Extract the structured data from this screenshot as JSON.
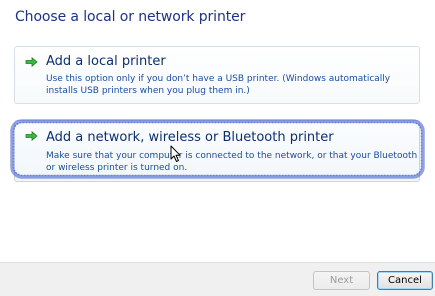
{
  "window": {
    "heading": "Choose a local or network printer"
  },
  "options": [
    {
      "title": "Add a local printer",
      "description": "Use this option only if you don’t have a USB printer. (Windows automatically installs USB printers when you plug them in.)",
      "icon": "green-arrow-icon"
    },
    {
      "title": "Add a network, wireless or Bluetooth printer",
      "description": "Make sure that your computer is connected to the network, or that your Bluetooth or wireless printer is turned on.",
      "icon": "green-arrow-icon"
    }
  ],
  "annotation": {
    "color": "#3a56c8"
  },
  "buttons": {
    "next": "Next",
    "cancel": "Cancel"
  }
}
